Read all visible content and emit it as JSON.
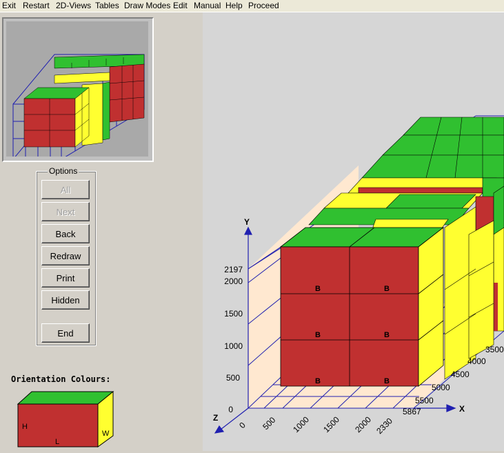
{
  "menu": [
    "Exit",
    "Restart",
    "2D-Views",
    "Tables",
    "Draw Modes",
    "Edit",
    "Manual",
    "Help",
    "Proceed"
  ],
  "options": {
    "title": "Options",
    "buttons": [
      {
        "label": "All",
        "enabled": false
      },
      {
        "label": "Next",
        "enabled": false
      },
      {
        "label": "Back",
        "enabled": true
      },
      {
        "label": "Redraw",
        "enabled": true
      },
      {
        "label": "Print",
        "enabled": true
      },
      {
        "label": "Hidden",
        "enabled": true
      },
      {
        "label": "End",
        "enabled": true
      }
    ]
  },
  "orientation": {
    "title": "Orientation Colours:",
    "labels": {
      "h": "H",
      "l": "L",
      "w": "W"
    }
  },
  "view3d": {
    "y_axis": {
      "name": "Y",
      "ticks": [
        "0",
        "500",
        "1000",
        "1500",
        "2000",
        "2197"
      ]
    },
    "z_axis": {
      "name": "Z",
      "ticks": [
        "0",
        "500",
        "1000",
        "1500",
        "2000",
        "2330"
      ]
    },
    "x_axis": {
      "name": "X",
      "ticks": [
        "3500",
        "4000",
        "4500",
        "5000",
        "5500",
        "5867"
      ]
    },
    "box_label": "B"
  },
  "colors": {
    "front_red": "#c03030",
    "top_green": "#30c030",
    "side_yellow": "#ffff30",
    "wire_blue": "#2020b0",
    "floor": "#ffe8d0"
  }
}
